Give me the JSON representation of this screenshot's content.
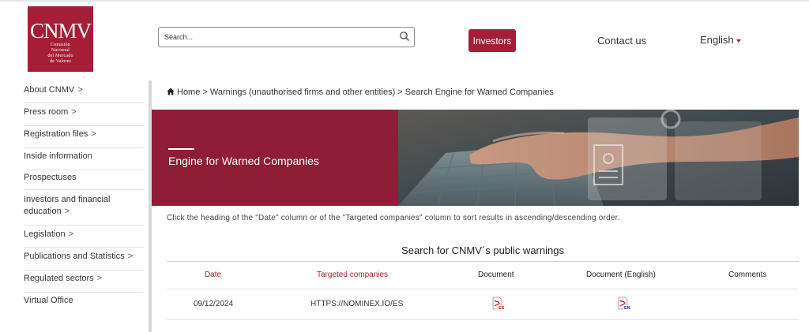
{
  "header": {
    "logo": {
      "mark": "CNMV",
      "line1": "Comisión",
      "line2": "Nacional",
      "line3": "del Mercado",
      "line4": "de Valores"
    },
    "search": {
      "placeholder": "Search..."
    },
    "investors_label": "Investors",
    "contact_label": "Contact us",
    "language_label": "English"
  },
  "sidebar": {
    "items": [
      {
        "label": "About CNMV",
        "chevron": ">"
      },
      {
        "label": "Press room",
        "chevron": ">"
      },
      {
        "label": "Registration files",
        "chevron": ">"
      },
      {
        "label": "Inside information"
      },
      {
        "label": "Prospectuses"
      },
      {
        "label": "Investors and financial",
        "label2": "education",
        "chevron": ">"
      },
      {
        "label": "Legislation",
        "chevron": ">"
      },
      {
        "label": "Publications and Statistics",
        "chevron": ">"
      },
      {
        "label": "Regulated sectors",
        "chevron": ">"
      },
      {
        "label": "Virtual Office"
      }
    ]
  },
  "breadcrumb": {
    "home": "Home",
    "rest": " > Warnings (unauthorised firms and other entities) > Search Engine for Warned Companies"
  },
  "banner": {
    "title": "Engine for Warned Companies"
  },
  "hint": "Click the heading of the \"Date\" column or of the \"Targeted companies\" column to sort results in ascending/descending order.",
  "table": {
    "title": "Search for CNMV´s public warnings",
    "headers": {
      "date": "Date",
      "companies": "Targeted companies",
      "document": "Document",
      "document_en": "Document (English)",
      "comments": "Comments"
    },
    "rows": [
      {
        "date": "09/12/2024",
        "company": "HTTPS://NOMINEX.IO/ES",
        "doc_tag": "ES",
        "doc_en_tag": "EN",
        "comments": ""
      }
    ]
  },
  "colors": {
    "brand": "#a51e36",
    "banner": "#8e1d35"
  }
}
